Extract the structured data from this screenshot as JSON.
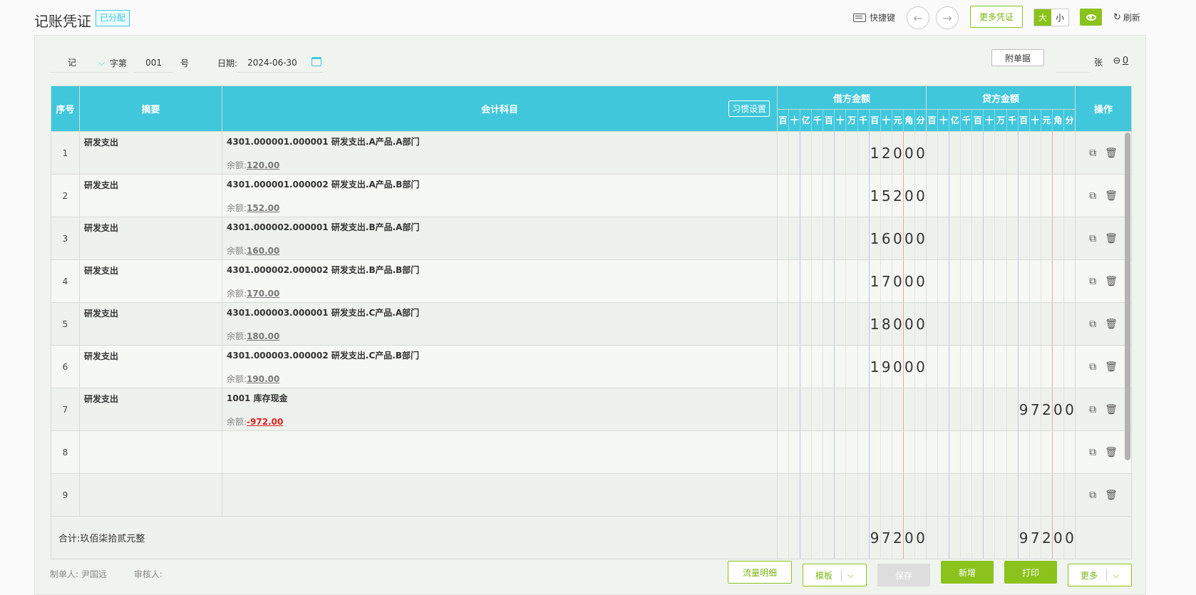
{
  "header": {
    "title": "记账凭证",
    "badge": "已分配",
    "shortcut_label": "快捷键",
    "more_vouchers": "更多凭证",
    "size_large": "大",
    "size_small": "小",
    "refresh": "刷新"
  },
  "meta": {
    "voucher_word": "记",
    "word_suffix": "字第",
    "number": "001",
    "number_suffix": "号",
    "date_label": "日期:",
    "date_value": "2024-06-30",
    "attachment_button": "附单据",
    "attachment_unit": "张",
    "attachment_count": "0"
  },
  "table": {
    "col_seq": "序号",
    "col_summary": "摘要",
    "col_subject": "会计科目",
    "habit_settings": "习惯设置",
    "col_debit": "借方金额",
    "col_credit": "贷方金额",
    "col_ops": "操作",
    "digit_units": [
      "百",
      "十",
      "亿",
      "千",
      "百",
      "十",
      "万",
      "千",
      "百",
      "十",
      "元",
      "角",
      "分"
    ],
    "balance_label": "余额:",
    "rows": [
      {
        "seq": "1",
        "summary": "研发支出",
        "subject": "4301.000001.000001 研发支出.A产品.A部门",
        "balance": "120.00",
        "debit": "12000",
        "credit": ""
      },
      {
        "seq": "2",
        "summary": "研发支出",
        "subject": "4301.000001.000002 研发支出.A产品.B部门",
        "balance": "152.00",
        "debit": "15200",
        "credit": ""
      },
      {
        "seq": "3",
        "summary": "研发支出",
        "subject": "4301.000002.000001 研发支出.B产品.A部门",
        "balance": "160.00",
        "debit": "16000",
        "credit": ""
      },
      {
        "seq": "4",
        "summary": "研发支出",
        "subject": "4301.000002.000002 研发支出.B产品.B部门",
        "balance": "170.00",
        "debit": "17000",
        "credit": ""
      },
      {
        "seq": "5",
        "summary": "研发支出",
        "subject": "4301.000003.000001 研发支出.C产品.A部门",
        "balance": "180.00",
        "debit": "18000",
        "credit": ""
      },
      {
        "seq": "6",
        "summary": "研发支出",
        "subject": "4301.000003.000002 研发支出.C产品.B部门",
        "balance": "190.00",
        "debit": "19000",
        "credit": ""
      },
      {
        "seq": "7",
        "summary": "研发支出",
        "subject": "1001 库存现金",
        "balance": "-972.00",
        "debit": "",
        "credit": "97200"
      },
      {
        "seq": "8",
        "summary": "",
        "subject": "",
        "balance": "",
        "debit": "",
        "credit": ""
      },
      {
        "seq": "9",
        "summary": "",
        "subject": "",
        "balance": "",
        "debit": "",
        "credit": ""
      }
    ],
    "total_label": "合计:玖佰柒拾贰元整",
    "total_debit": "97200",
    "total_credit": "97200"
  },
  "footer": {
    "maker_label": "制单人:",
    "maker_name": "尹国远",
    "reviewer_label": "审核人:",
    "reviewer_name": "",
    "flow_detail": "流量明细",
    "template": "模板",
    "save": "保存",
    "add": "新增",
    "print": "打印",
    "more": "更多"
  },
  "colors": {
    "accent_green": "#8bc21c",
    "header_cyan": "#40c7dc",
    "negative_red": "#e02020"
  }
}
